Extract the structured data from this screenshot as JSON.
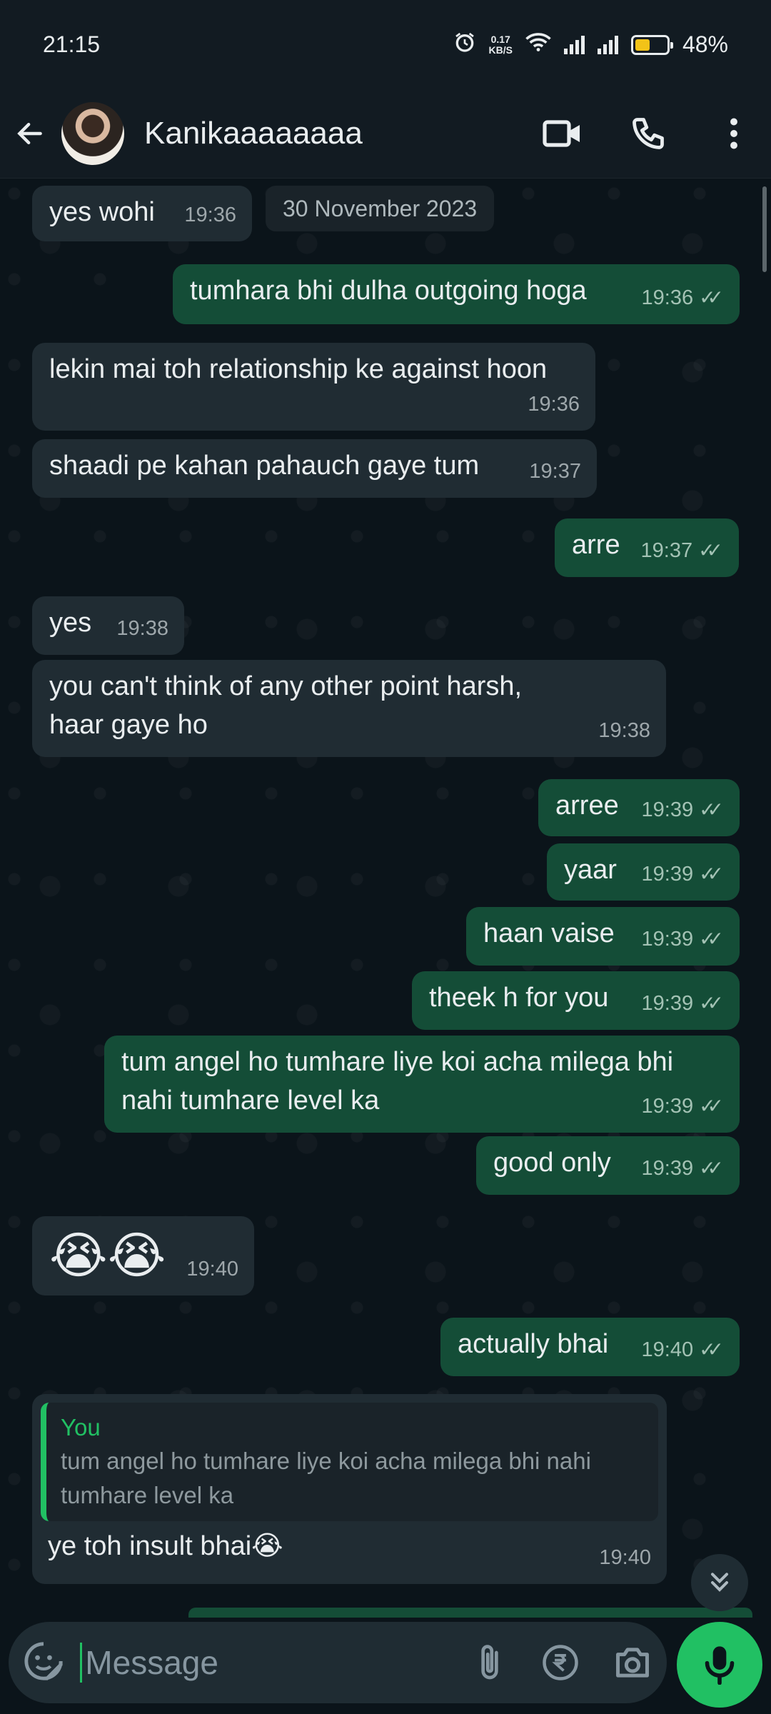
{
  "status_bar": {
    "time": "21:15",
    "net_speed_value": "0.17",
    "net_speed_unit": "KB/S",
    "battery": "48%"
  },
  "header": {
    "contact_name": "Kanikaaaaaaaa"
  },
  "chat": {
    "date_chip": "30 November 2023",
    "messages": [
      {
        "dir": "in",
        "text": "yes wohi",
        "time": "19:36"
      },
      {
        "dir": "out",
        "text": "tumhara bhi dulha outgoing hoga",
        "time": "19:36"
      },
      {
        "dir": "in",
        "text": "lekin mai toh relationship ke against hoon",
        "time": "19:36"
      },
      {
        "dir": "in",
        "text": "shaadi pe kahan pahauch gaye tum",
        "time": "19:37"
      },
      {
        "dir": "out",
        "text": "arre",
        "time": "19:37"
      },
      {
        "dir": "in",
        "text": "yes",
        "time": "19:38"
      },
      {
        "dir": "in",
        "text": "you can't think of any other point harsh, haar gaye ho",
        "time": "19:38"
      },
      {
        "dir": "out",
        "text": "arree",
        "time": "19:39"
      },
      {
        "dir": "out",
        "text": "yaar",
        "time": "19:39"
      },
      {
        "dir": "out",
        "text": "haan vaise",
        "time": "19:39"
      },
      {
        "dir": "out",
        "text": "theek h for you",
        "time": "19:39"
      },
      {
        "dir": "out",
        "text": "tum angel ho tumhare liye koi acha milega bhi nahi tumhare level ka",
        "time": "19:39"
      },
      {
        "dir": "out",
        "text": "good only",
        "time": "19:39"
      },
      {
        "dir": "in",
        "text": "😭😭",
        "time": "19:40"
      },
      {
        "dir": "out",
        "text": "actually bhai",
        "time": "19:40"
      },
      {
        "dir": "in",
        "text": "ye toh insult bhai😭",
        "time": "19:40",
        "reply": {
          "author": "You",
          "text": "tum angel ho tumhare liye koi acha milega bhi nahi tumhare level ka"
        }
      }
    ]
  },
  "input": {
    "placeholder": "Message"
  },
  "colors": {
    "background": "#0b141a",
    "incoming_bubble": "#202c33",
    "outgoing_bubble": "#144d37",
    "accent_green": "#21c063",
    "battery_fill": "#f2c318"
  },
  "icons": [
    "back-arrow-icon",
    "video-call-icon",
    "voice-call-icon",
    "more-options-icon",
    "alarm-icon",
    "wifi-icon",
    "sticker-icon",
    "attach-icon",
    "rupee-payment-icon",
    "camera-icon",
    "mic-icon",
    "scroll-down-icon"
  ]
}
